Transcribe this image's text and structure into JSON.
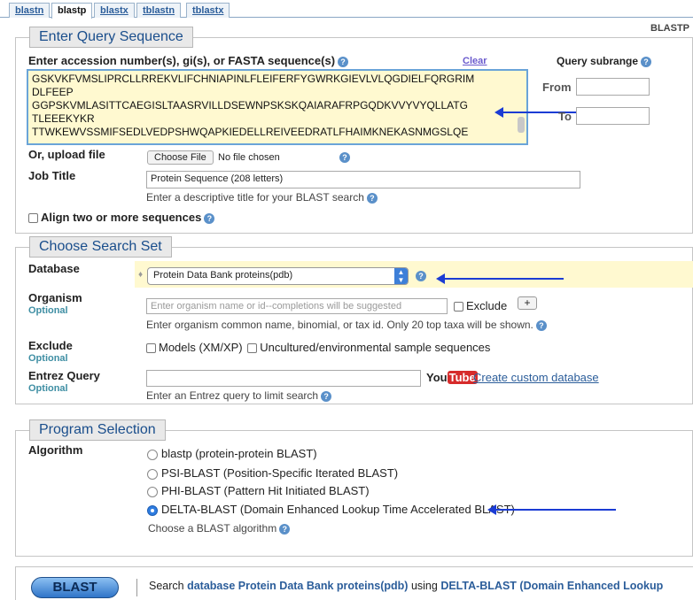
{
  "tabs": [
    "blastn",
    "blastp",
    "blastx",
    "tblastn",
    "tblastx"
  ],
  "app_label": "BLASTP",
  "query": {
    "legend": "Enter Query Sequence",
    "label": "Enter accession number(s), gi(s), or FASTA sequence(s)",
    "clear": "Clear",
    "sequence_lines": [
      "GSKVKFVMSLIPRCLLRREKVLIFCHNIAPINLFLEIFERFYGWRKGIEVLVLQGDIELFQRGRIM",
      "DLFEEP",
      "GGPSKVMLASITTCAEGISLTAASRVILLDSEWNPSKSKQAIARAFRPGQDKVVYVYQLLATG",
      "TLEEEKYKR",
      "TTWKEWVSSMIFSEDLVEDPSHWQAPKIEDELLREIVEEDRATLFHAIMKNEKASNMGSLQE"
    ],
    "subrange_title": "Query subrange",
    "from_label": "From",
    "to_label": "To",
    "upload_label": "Or, upload file",
    "choose_file": "Choose File",
    "no_file": "No file chosen",
    "job_title_label": "Job Title",
    "job_title_value": "Protein Sequence (208 letters)",
    "job_title_hint": "Enter a descriptive title for your BLAST search",
    "align_label": "Align two or more sequences"
  },
  "search_set": {
    "legend": "Choose Search Set",
    "database_label": "Database",
    "database_value": "Protein Data Bank proteins(pdb)",
    "organism_label": "Organism",
    "optional": "Optional",
    "organism_placeholder": "Enter organism name or id--completions will be suggested",
    "exclude_check": "Exclude",
    "plus": "+",
    "organism_hint": "Enter organism common name, binomial, or tax id. Only 20 top taxa will be shown.",
    "exclude_label": "Exclude",
    "models": "Models (XM/XP)",
    "uncultured": "Uncultured/environmental sample sequences",
    "entrez_label": "Entrez Query",
    "youtube": "You",
    "tube": "Tube",
    "custom_db": "Create custom database",
    "entrez_hint": "Enter an Entrez query to limit search"
  },
  "program": {
    "legend": "Program Selection",
    "algorithm_label": "Algorithm",
    "options": [
      "blastp (protein-protein BLAST)",
      "PSI-BLAST (Position-Specific Iterated BLAST)",
      "PHI-BLAST (Pattern Hit Initiated BLAST)",
      "DELTA-BLAST (Domain Enhanced Lookup Time Accelerated BLAST)"
    ],
    "selected_index": 3,
    "hint": "Choose a BLAST algorithm"
  },
  "footer": {
    "blast_button": "BLAST",
    "search_prefix": "Search",
    "search_db": "database Protein Data Bank proteins(pdb)",
    "using": "using",
    "algo": "DELTA-BLAST (Domain Enhanced Lookup"
  },
  "colors": {
    "annotation_arrow": "#1b3cd4",
    "link": "#2b5d9a",
    "legend_text": "#1a4e8c"
  }
}
